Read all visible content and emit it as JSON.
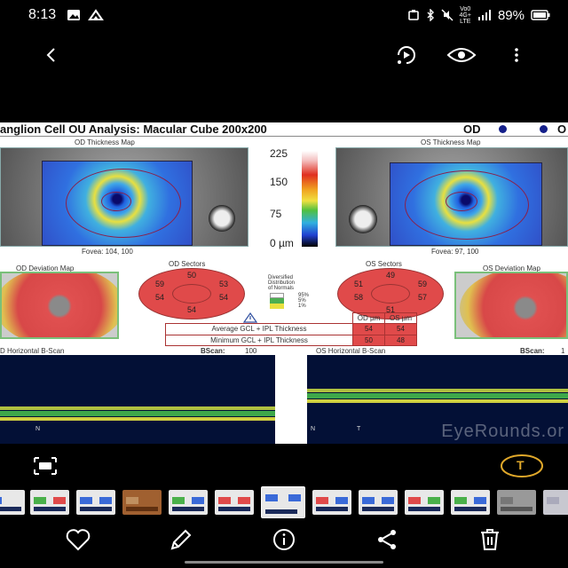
{
  "status_bar": {
    "time": "8:13",
    "network_top": "Vo0",
    "network_label": "4G+",
    "network_bottom": "LTE",
    "battery": "89%"
  },
  "viewer": {
    "report": {
      "title": "anglion Cell OU Analysis: Macular Cube 200x200",
      "od_label": "OD",
      "os_label": "O",
      "od_thickness_caption": "OD Thickness Map",
      "os_thickness_caption": "OS Thickness Map",
      "od_fovea": "Fovea: 104, 100",
      "os_fovea": "Fovea: 97, 100",
      "scale_labels": [
        "225",
        "150",
        "75",
        "0 µm"
      ],
      "od_deviation_caption": "OD Deviation Map",
      "os_deviation_caption": "OS Deviation Map",
      "od_sectors_caption": "OD Sectors",
      "os_sectors_caption": "OS Sectors",
      "od_sectors": {
        "top": "50",
        "upper_left": "59",
        "upper_right": "53",
        "lower_left": "54",
        "lower_right": "54",
        "bottom": "54"
      },
      "os_sectors": {
        "top": "49",
        "upper_left": "51",
        "upper_right": "59",
        "lower_left": "58",
        "lower_right": "57",
        "bottom": "51"
      },
      "legend": {
        "title_1": "Diversified",
        "title_2": "Distribution",
        "title_3": "of Normals",
        "p95": "95%",
        "p5": "5%",
        "p1": "1%"
      },
      "table": {
        "head_od": "OD µm",
        "head_os": "OS µm",
        "rows": [
          {
            "label": "Average GCL + IPL Thickness",
            "od": "54",
            "os": "54"
          },
          {
            "label": "Minimum GCL + IPL Thickness",
            "od": "50",
            "os": "48"
          }
        ]
      },
      "od_bscan_caption": "D Horizontal B-Scan",
      "od_bscan_label": "BScan:",
      "od_bscan_value": "100",
      "os_bscan_caption": "OS Horizontal B-Scan",
      "os_bscan_label": "BScan:",
      "os_bscan_value": "1",
      "od_corner": "N",
      "os_corner_n": "N",
      "os_corner_t": "T",
      "watermark": "EyeRounds.or"
    }
  },
  "toolbar_text_button": "T",
  "colors": {
    "accent_gold": "#e0a82a",
    "sector_red": "#e04a4a",
    "bscan_bg": "#031036"
  }
}
